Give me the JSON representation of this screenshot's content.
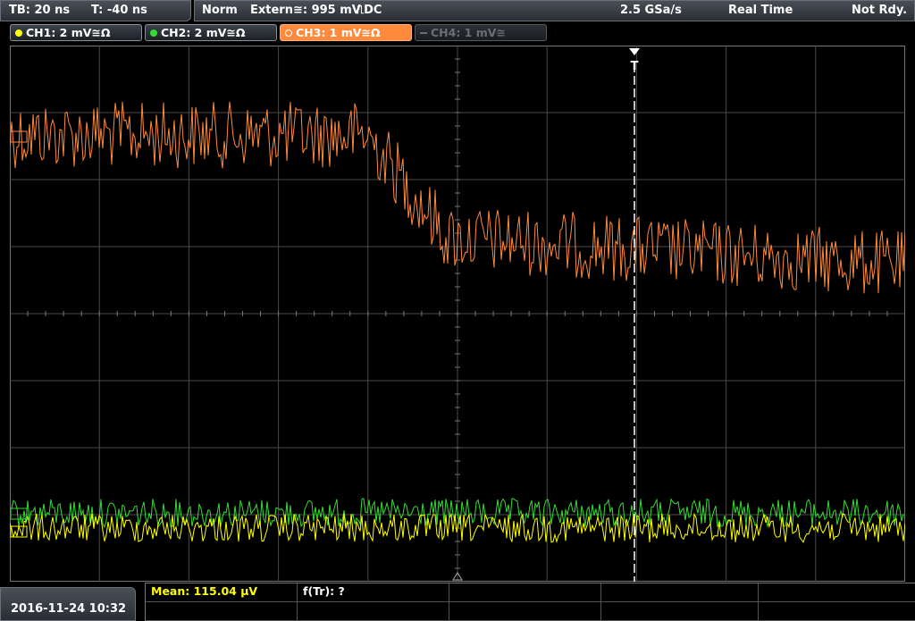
{
  "timebase": {
    "tb_label": "TB: 20 ns",
    "trigger_time_label": "T: -40 ns"
  },
  "status": {
    "mode": "Norm",
    "trigger_source": "Extern≅: 995 mV",
    "trigger_slope": "⎍DC",
    "sample_rate": "2.5 GSa/s",
    "acq_mode": "Real Time",
    "state": "Not Rdy."
  },
  "channels": [
    {
      "label": "CH1: 2 mV≅Ω",
      "color": "#ffff00",
      "state": "on"
    },
    {
      "label": "CH2: 2 mV≅Ω",
      "color": "#33dd33",
      "state": "on"
    },
    {
      "label": "CH3: 1 mV≅Ω",
      "color": "#ff8a3c",
      "state": "active"
    },
    {
      "label": "CH4: 1 mV≅",
      "color": "#6a6e75",
      "state": "off"
    }
  ],
  "trigger_marker": "T",
  "measurements": {
    "mean": "Mean: 115.04 µV",
    "rise_time": "f(Tr): ?"
  },
  "datetime": "2016-11-24 10:32",
  "colors": {
    "ch1": "#ffff00",
    "ch2": "#33dd33",
    "ch3": "#ff8a3c",
    "grid": "#4a4a4a"
  }
}
